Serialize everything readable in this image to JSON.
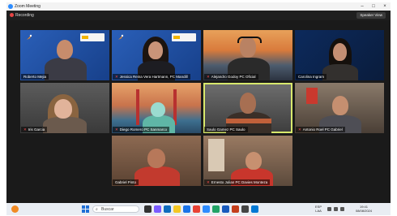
{
  "window": {
    "title": "Zoom Meeting",
    "minimize_glyph": "–",
    "maximize_glyph": "□",
    "close_glyph": "×"
  },
  "topbar": {
    "recording_label": "Recording",
    "speaker_view_label": "Speaker View"
  },
  "participants": [
    {
      "name": "Roberto Mejia",
      "muted": false
    },
    {
      "name": "Jessica Reina Vera Hartmann, PC Mandill",
      "muted": true
    },
    {
      "name": "Alejandro Godoy PC Oficial",
      "muted": true
    },
    {
      "name": "Carolina Ingram",
      "muted": false
    },
    {
      "name": "Iris Garcia",
      "muted": true
    },
    {
      "name": "Diego Romero PC Sanmarco",
      "muted": true
    },
    {
      "name": "Saulo Gamez PC Saulo",
      "muted": false
    },
    {
      "name": "Antonio Roel PC Gabriel",
      "muted": true
    },
    {
      "name": "Gabriel Pinto",
      "muted": false
    },
    {
      "name": "Ernesto Julian PC Davies Monteza",
      "muted": true
    }
  ],
  "mic_off_glyph": "✕",
  "taskbar": {
    "search_placeholder": "Buscar",
    "search_glyph": "⌕",
    "lang": "ESP",
    "lang_sub": "LAA",
    "time": "19:41",
    "date": "08/08/2024"
  },
  "colors": {
    "active_speaker_border": "#d8e86c",
    "tile_background": "#333333",
    "taskbar_background": "#e9edf3"
  }
}
